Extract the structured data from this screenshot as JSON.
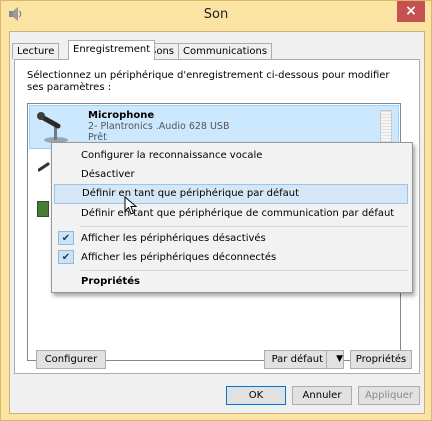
{
  "window": {
    "title": "Son",
    "close_glyph": "×"
  },
  "tabs": [
    {
      "label": "Lecture",
      "active": false
    },
    {
      "label": "Enregistrement",
      "active": true
    },
    {
      "label": "Sons",
      "active": false
    },
    {
      "label": "Communications",
      "active": false
    }
  ],
  "panel": {
    "instruction": "Sélectionnez un périphérique d'enregistrement ci-dessous pour modifier ses paramètres :"
  },
  "device": {
    "name": "Microphone",
    "sub": "2- Plantronics .Audio 628 USB",
    "status": "Prêt",
    "icon": "microphone-icon"
  },
  "context_menu": {
    "items": [
      {
        "label": "Configurer la reconnaissance vocale"
      },
      {
        "label": "Désactiver"
      },
      {
        "label": "Définir en tant que périphérique par défaut",
        "hover": true
      },
      {
        "label": "Définir en tant que périphérique de communication par défaut"
      },
      {
        "label": "Afficher les périphériques désactivés",
        "checked": true
      },
      {
        "label": "Afficher les périphériques déconnectés",
        "checked": true
      },
      {
        "label": "Propriétés",
        "bold": true
      }
    ],
    "check_glyph": "✔"
  },
  "buttons": {
    "configure": "Configurer",
    "set_default": "Par défaut",
    "set_default_arrow": "▼",
    "properties": "Propriétés",
    "ok": "OK",
    "cancel": "Annuler",
    "apply": "Appliquer"
  },
  "colors": {
    "titlebar": "#fbe3a3",
    "close": "#c75050",
    "selection": "#cce8ff",
    "menu_hover": "#d5e6f7"
  }
}
